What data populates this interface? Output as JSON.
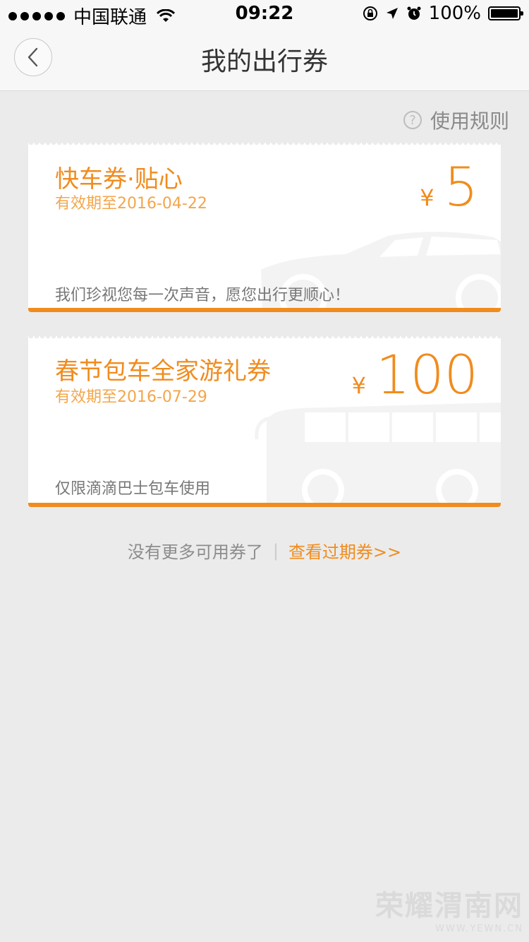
{
  "status_bar": {
    "carrier": "中国联通",
    "time": "09:22",
    "battery": "100%",
    "icons": [
      "signal-dots-icon",
      "wifi-icon",
      "orientation-lock-icon",
      "location-icon",
      "alarm-icon",
      "battery-icon"
    ]
  },
  "nav": {
    "title": "我的出行券",
    "back_icon": "chevron-left-icon"
  },
  "rules": {
    "icon": "question-circle-icon",
    "icon_glyph": "?",
    "label": "使用规则"
  },
  "coupons": [
    {
      "title": "快车券·贴心",
      "expiry": "有效期至2016-04-22",
      "currency": "¥",
      "amount": "5",
      "description": "我们珍视您每一次声音，愿您出行更顺心！",
      "illustration": "car-icon"
    },
    {
      "title": "春节包车全家游礼券",
      "expiry": "有效期至2016-07-29",
      "currency": "¥",
      "amount": "100",
      "description": "仅限滴滴巴士包车使用",
      "illustration": "bus-icon"
    }
  ],
  "footer": {
    "no_more_text": "没有更多可用券了",
    "separator": "|",
    "expired_link": "查看过期券>>"
  },
  "watermark": {
    "main": "荣耀渭南网",
    "sub": "WWW.YEWN.CN"
  },
  "colors": {
    "accent": "#f08c1e",
    "background": "#ebebeb",
    "card": "#ffffff"
  }
}
